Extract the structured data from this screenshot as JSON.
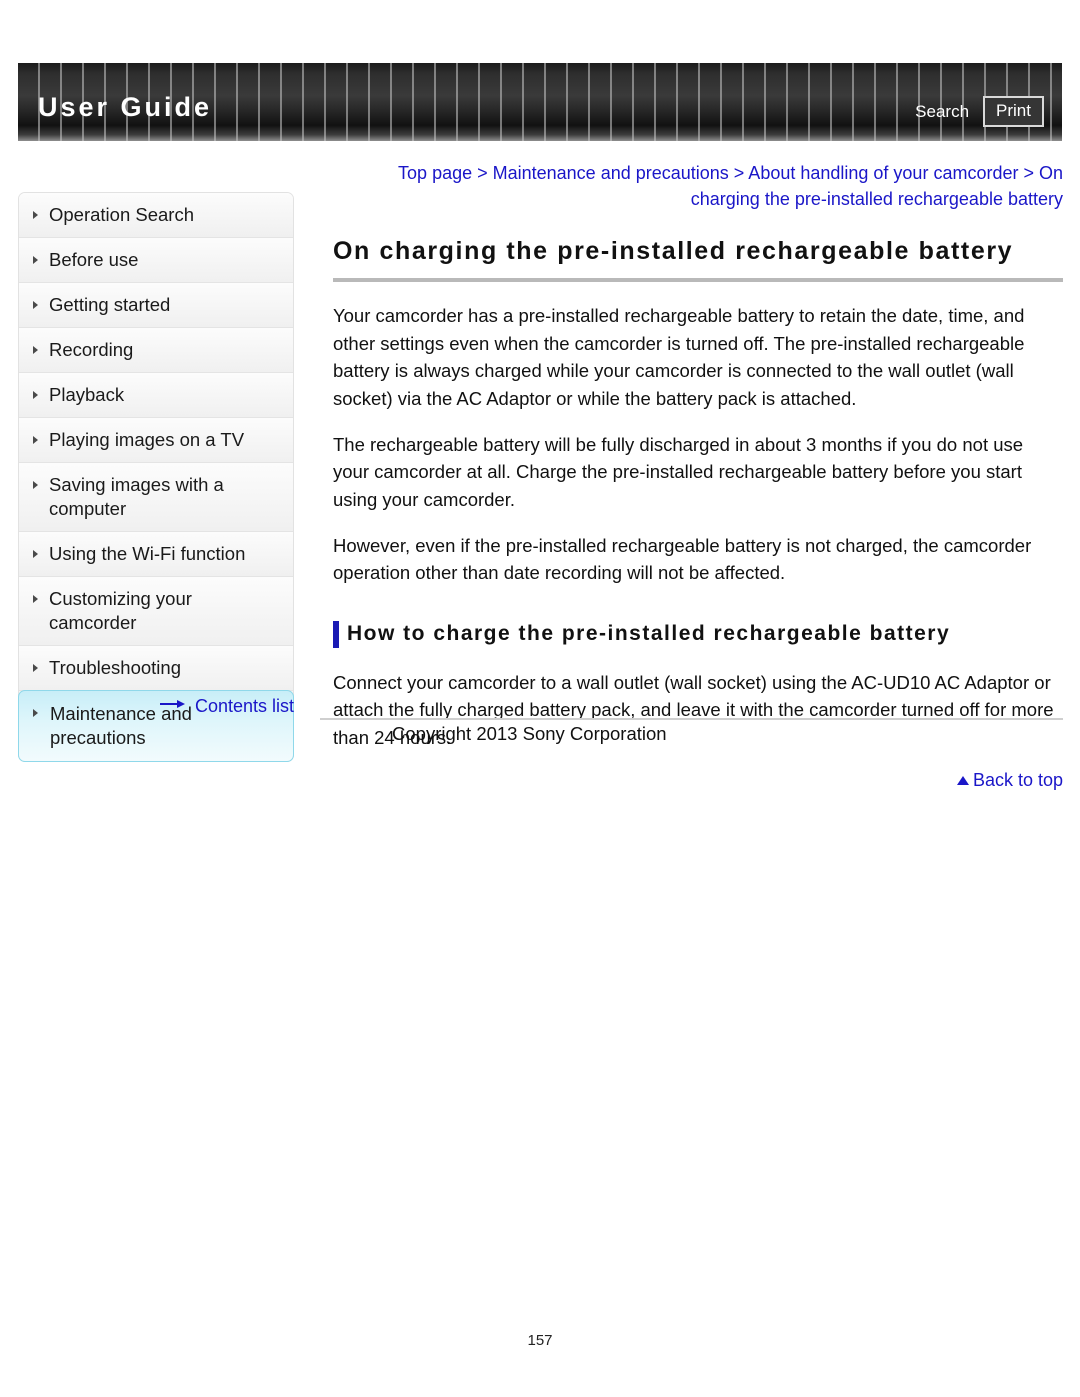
{
  "header": {
    "title": "User Guide",
    "search_label": "Search",
    "print_label": "Print"
  },
  "sidebar": {
    "items": [
      {
        "label": "Operation Search",
        "active": false
      },
      {
        "label": "Before use",
        "active": false
      },
      {
        "label": "Getting started",
        "active": false
      },
      {
        "label": "Recording",
        "active": false
      },
      {
        "label": "Playback",
        "active": false
      },
      {
        "label": "Playing images on a TV",
        "active": false
      },
      {
        "label": "Saving images with a computer",
        "active": false
      },
      {
        "label": "Using the Wi-Fi function",
        "active": false
      },
      {
        "label": "Customizing your camcorder",
        "active": false
      },
      {
        "label": "Troubleshooting",
        "active": false
      },
      {
        "label": "Maintenance and precautions",
        "active": true
      }
    ],
    "contents_list_label": "Contents list"
  },
  "main": {
    "breadcrumb": "Top page > Maintenance and precautions > About handling of your camcorder > On charging the pre-installed rechargeable battery",
    "page_title": "On charging the pre-installed rechargeable battery",
    "paragraphs": [
      "Your camcorder has a pre-installed rechargeable battery to retain the date, time, and other settings even when the camcorder is turned off. The pre-installed rechargeable battery is always charged while your camcorder is connected to the wall outlet (wall socket) via the AC Adaptor or while the battery pack is attached.",
      "The rechargeable battery will be fully discharged in about 3 months if you do not use your camcorder at all. Charge the pre-installed rechargeable battery before you start using your camcorder.",
      "However, even if the pre-installed rechargeable battery is not charged, the camcorder operation other than date recording will not be affected."
    ],
    "section_heading": "How to charge the pre-installed rechargeable battery",
    "section_paragraph": "Connect your camcorder to a wall outlet (wall socket) using the AC-UD10 AC Adaptor or attach the fully charged battery pack, and leave it with the camcorder turned off for more than 24 hours.",
    "back_to_top_label": "Back to top"
  },
  "footer": {
    "copyright": "Copyright 2013 Sony Corporation",
    "page_number": "157"
  },
  "colors": {
    "link": "#1a16c8",
    "accent_bar": "#1a1ab4",
    "active_item": "#c8eef8",
    "header_bg": "#1b1b1b"
  }
}
